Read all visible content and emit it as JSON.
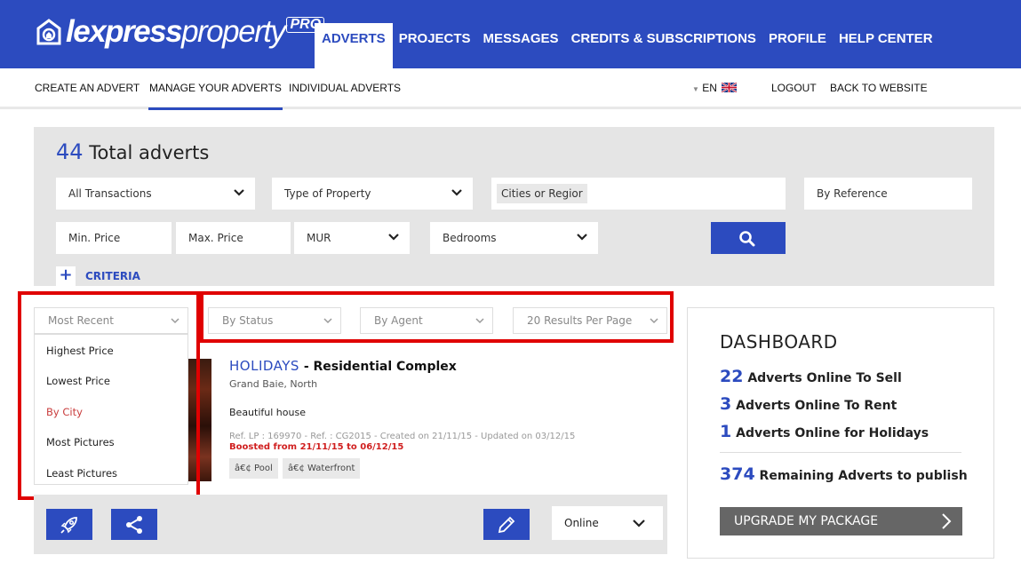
{
  "brand": {
    "name_light": "lexpress",
    "name_regular": "property",
    "badge": "PRO"
  },
  "main_nav": [
    "ADVERTS",
    "PROJECTS",
    "MESSAGES",
    "CREDITS & SUBSCRIPTIONS",
    "PROFILE",
    "HELP CENTER"
  ],
  "sub_nav": {
    "create": "CREATE AN ADVERT",
    "manage": "MANAGE YOUR ADVERTS",
    "individual": "INDIVIDUAL ADVERTS",
    "lang": "EN",
    "logout": "LOGOUT",
    "back": "BACK TO WEBSITE"
  },
  "search": {
    "total_count": "44",
    "total_label": "Total adverts",
    "transactions": "All Transactions",
    "property_type": "Type of Property",
    "cities": "Cities or Regior",
    "reference": "By Reference",
    "min_price": "Min. Price",
    "max_price": "Max. Price",
    "currency": "MUR",
    "bedrooms": "Bedrooms",
    "criteria": "CRITERIA"
  },
  "filters": {
    "sort": "Most Recent",
    "status": "By Status",
    "agent": "By Agent",
    "per_page": "20 Results Per Page",
    "sort_options": [
      "Highest Price",
      "Lowest Price",
      "By City",
      "Most Pictures",
      "Least Pictures"
    ]
  },
  "listing": {
    "category": "HOLIDAYS",
    "type": "- Residential Complex",
    "location": "Grand Baie, North",
    "description": "Beautiful house",
    "meta": "Ref. LP : 169970 - Ref. : CG2015 - Created on 21/11/15 - Updated on 03/12/15",
    "boost": "Boosted from 21/11/15 to 06/12/15",
    "tags": [
      "â€¢ Pool",
      "â€¢ Waterfront"
    ],
    "status": "Online"
  },
  "dashboard": {
    "title": "DASHBOARD",
    "sell_count": "22",
    "sell_label": "Adverts Online To Sell",
    "rent_count": "3",
    "rent_label": "Adverts Online To Rent",
    "holiday_count": "1",
    "holiday_label": "Adverts Online for Holidays",
    "remaining_count": "374",
    "remaining_label": "Remaining Adverts to publish",
    "upgrade": "UPGRADE MY PACKAGE"
  },
  "colors": {
    "brand_blue": "#2c4bbf",
    "highlight_red": "#e00000",
    "selected_option": "#c93d3d"
  }
}
